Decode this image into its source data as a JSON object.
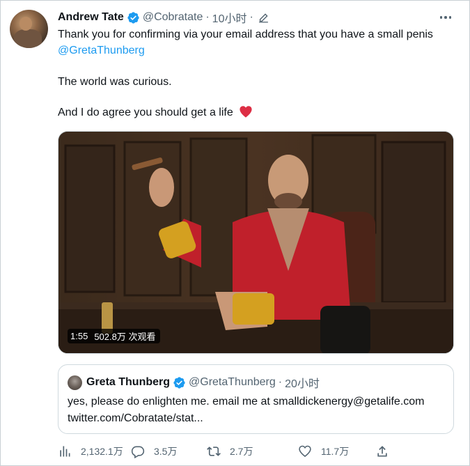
{
  "tweet": {
    "author_name": "Andrew Tate",
    "author_handle": "@Cobratate",
    "time": "10小时",
    "separator": "·",
    "line1": "Thank you for confirming via your email address that you have a small penis",
    "mention": "@GretaThunberg",
    "line2": "The world was curious.",
    "line3": "And I do agree you should get a life",
    "icons": {
      "verified": "verified-badge-icon",
      "edit": "edited-pencil-icon",
      "more": "more-options-icon",
      "heart": "red-heart-emoji"
    },
    "colors": {
      "link": "#1d9bf0",
      "verified": "#1d9bf0",
      "heart": "#dd2e44",
      "muted": "#536471"
    }
  },
  "video": {
    "duration": "1:55",
    "views": "502.8万 次观看"
  },
  "quote": {
    "author_name": "Greta Thunberg",
    "author_handle": "@GretaThunberg",
    "time": "20小时",
    "separator": "·",
    "text": "yes, please do enlighten me. email me at smalldickenergy@getalife.com twitter.com/Cobratate/stat..."
  },
  "actions": {
    "views": {
      "icon": "analytics-bar-icon",
      "count": "2,132.1万"
    },
    "reply": {
      "icon": "reply-bubble-icon",
      "count": "3.5万"
    },
    "retweet": {
      "icon": "retweet-icon",
      "count": "2.7万"
    },
    "like": {
      "icon": "like-heart-icon",
      "count": "11.7万"
    },
    "share": {
      "icon": "share-upload-icon"
    }
  }
}
